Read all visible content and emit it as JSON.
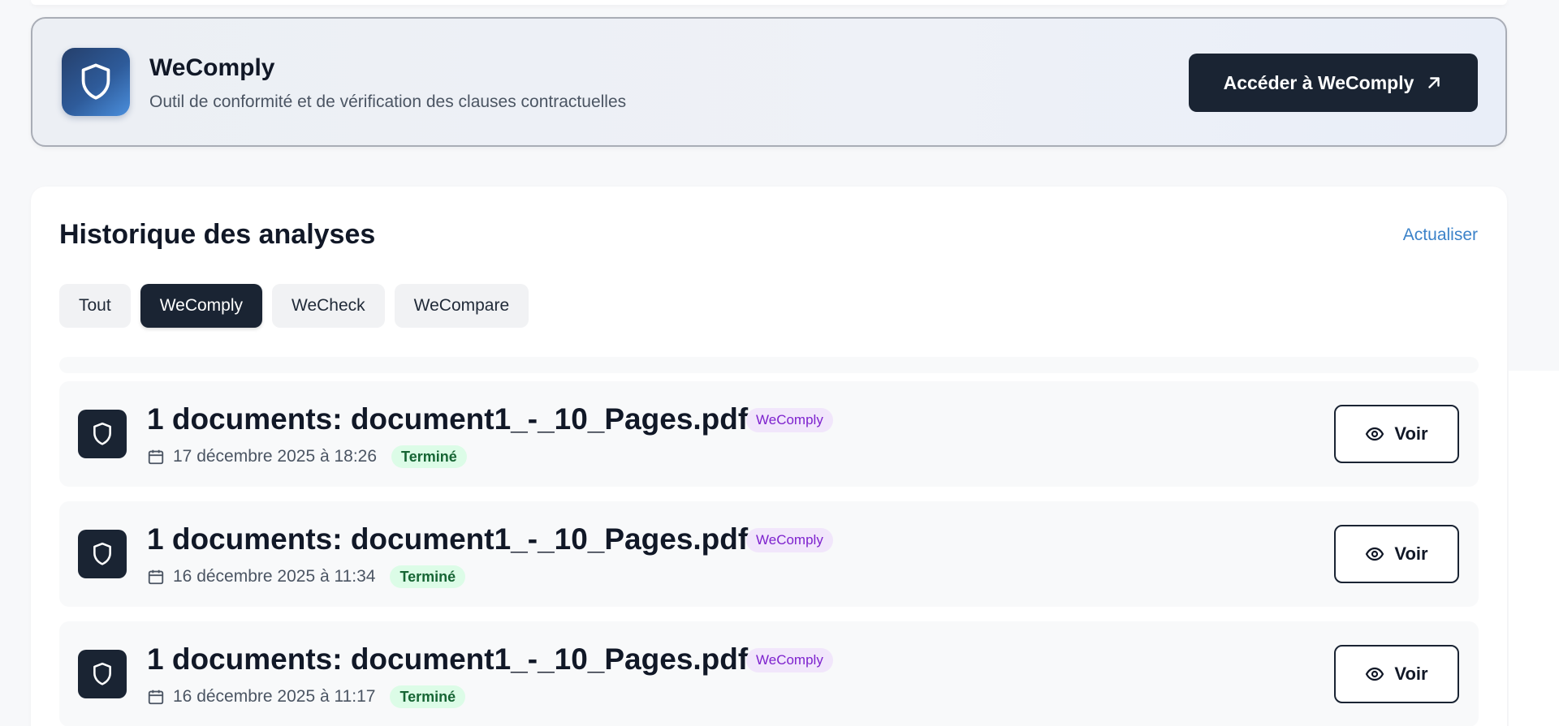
{
  "tool_card": {
    "title": "WeComply",
    "subtitle": "Outil de conformité et de vérification des clauses contractuelles",
    "access_label": "Accéder à WeComply",
    "icon": "shield-icon"
  },
  "history": {
    "title": "Historique des analyses",
    "refresh_label": "Actualiser",
    "filters": [
      {
        "label": "Tout",
        "active": false
      },
      {
        "label": "WeComply",
        "active": true
      },
      {
        "label": "WeCheck",
        "active": false
      },
      {
        "label": "WeCompare",
        "active": false
      }
    ],
    "rows": [
      {
        "title": "1 documents: document1_-_10_Pages.pdf",
        "tool": "WeComply",
        "date": "17 décembre 2025 à 18:26",
        "status": "Terminé",
        "action": "Voir"
      },
      {
        "title": "1 documents: document1_-_10_Pages.pdf",
        "tool": "WeComply",
        "date": "16 décembre 2025 à 11:34",
        "status": "Terminé",
        "action": "Voir"
      },
      {
        "title": "1 documents: document1_-_10_Pages.pdf",
        "tool": "WeComply",
        "date": "16 décembre 2025 à 11:17",
        "status": "Terminé",
        "action": "Voir"
      }
    ]
  },
  "colors": {
    "primary_dark": "#1a2433",
    "link_blue": "#3b82c9",
    "badge_purple": "#7e22ce",
    "status_green": "#166534"
  }
}
